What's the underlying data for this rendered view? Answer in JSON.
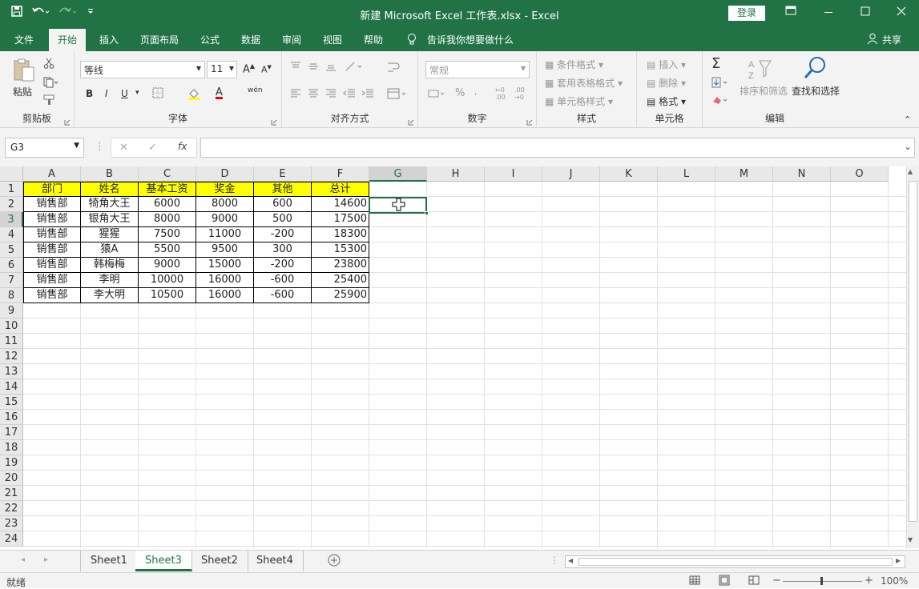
{
  "titlebar": {
    "title": "新建 Microsoft Excel 工作表.xlsx  -  Excel",
    "login": "登录",
    "save_icon": "save-icon",
    "undo_icon": "undo-icon",
    "redo_icon": "redo-icon",
    "customize_icon": "customize-icon"
  },
  "tabs": [
    "文件",
    "开始",
    "插入",
    "页面布局",
    "公式",
    "数据",
    "审阅",
    "视图",
    "帮助"
  ],
  "active_tab": "开始",
  "tell_me": "告诉我你想要做什么",
  "share": "共享",
  "ribbon": {
    "clipboard": {
      "label": "剪贴板",
      "paste": "粘贴"
    },
    "font": {
      "label": "字体",
      "font_name": "等线",
      "font_size": "11",
      "bold": "B",
      "italic": "I",
      "underline": "U",
      "font_color": "A",
      "phonetic": "wén"
    },
    "alignment": {
      "label": "对齐方式"
    },
    "number": {
      "label": "数字",
      "format": "常规",
      "percent": "%"
    },
    "styles": {
      "label": "样式",
      "conditional": "条件格式",
      "table": "套用表格格式",
      "cell_styles": "单元格样式"
    },
    "cells": {
      "label": "单元格",
      "insert": "插入",
      "delete": "删除",
      "format": "格式"
    },
    "editing": {
      "label": "编辑",
      "sort": "排序和筛选",
      "find": "查找和选择",
      "sigma": "Σ"
    }
  },
  "formula": {
    "namebox": "G3",
    "fx": "fx",
    "content": ""
  },
  "columns": [
    "A",
    "B",
    "C",
    "D",
    "E",
    "F",
    "G",
    "H",
    "I",
    "J",
    "K",
    "L",
    "M",
    "N",
    "O"
  ],
  "selected_col": "G",
  "selected_row": 3,
  "rows": [
    1,
    2,
    3,
    4,
    5,
    6,
    7,
    8,
    9,
    10,
    11,
    12,
    13,
    14,
    15,
    16,
    17,
    18,
    19,
    20,
    21,
    22,
    23,
    24
  ],
  "table": {
    "headers": [
      "部门",
      "姓名",
      "基本工资",
      "奖金",
      "其他",
      "总计"
    ],
    "data": [
      [
        "销售部",
        "犄角大王",
        "6000",
        "8000",
        "600",
        "14600"
      ],
      [
        "销售部",
        "银角大王",
        "8000",
        "9000",
        "500",
        "17500"
      ],
      [
        "销售部",
        "猩猩",
        "7500",
        "11000",
        "-200",
        "18300"
      ],
      [
        "销售部",
        "猿A",
        "5500",
        "9500",
        "300",
        "15300"
      ],
      [
        "销售部",
        "韩梅梅",
        "9000",
        "15000",
        "-200",
        "23800"
      ],
      [
        "销售部",
        "李明",
        "10000",
        "16000",
        "-600",
        "25400"
      ],
      [
        "销售部",
        "李大明",
        "10500",
        "16000",
        "-600",
        "25900"
      ]
    ]
  },
  "sheets": [
    "Sheet1",
    "Sheet3",
    "Sheet2",
    "Sheet4"
  ],
  "active_sheet": "Sheet3",
  "status": {
    "ready": "就绪",
    "zoom": "100%"
  },
  "colors": {
    "accent": "#217346",
    "header_fill": "#ffff00"
  }
}
